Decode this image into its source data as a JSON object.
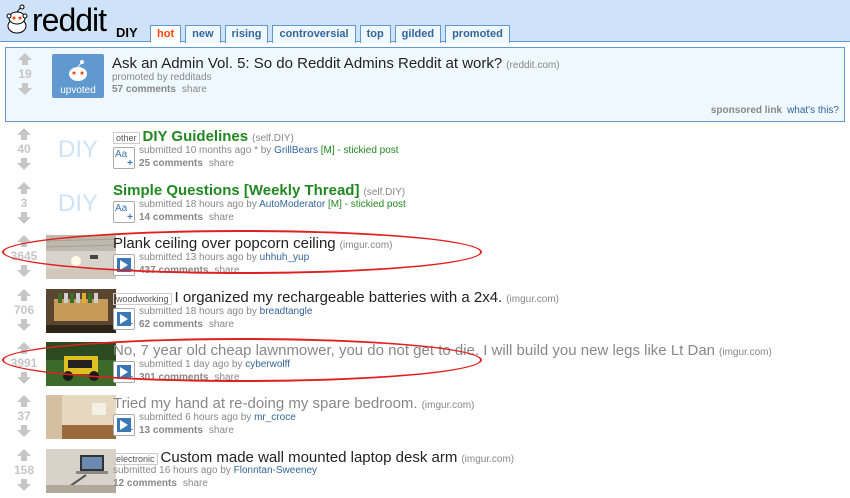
{
  "header": {
    "logo_text": "reddit",
    "subreddit": "DIY",
    "tabs": [
      "hot",
      "new",
      "rising",
      "controversial",
      "top",
      "gilded",
      "promoted"
    ],
    "selected_tab": "hot"
  },
  "sponsored": {
    "score": "19",
    "thumb_label": "upvoted",
    "title": "Ask an Admin Vol. 5: So do Reddit Admins Reddit at work?",
    "domain": "(reddit.com)",
    "tagline": "promoted by redditads",
    "comments": "57 comments",
    "share": "share",
    "sponsored_label": "sponsored link",
    "whats_this": "what's this?"
  },
  "posts": [
    {
      "score": "40",
      "watermark": "DIY",
      "flair": "other",
      "title": "DIY Guidelines",
      "domain": "(self.DIY)",
      "tag_prefix": "submitted 10 months ago * by ",
      "author": "GrillBears",
      "tag_suffix": " [M] - stickied post",
      "comments": "25 comments",
      "share": "share"
    },
    {
      "score": "3",
      "watermark": "DIY",
      "title": "Simple Questions [Weekly Thread]",
      "domain": "(self.DIY)",
      "tag_prefix": "submitted 18 hours ago by ",
      "author": "AutoModerator",
      "tag_suffix": " [M] - stickied post",
      "comments": "14 comments",
      "share": "share"
    },
    {
      "score": "3645",
      "title": "Plank ceiling over popcorn ceiling",
      "domain": "(imgur.com)",
      "tag_prefix": "submitted 13 hours ago by ",
      "author": "uhhuh_yup",
      "comments": "437 comments",
      "share": "share"
    },
    {
      "score": "706",
      "flair": "woodworking",
      "title": "I organized my rechargeable batteries with a 2x4.",
      "domain": "(imgur.com)",
      "tag_prefix": "submitted 18 hours ago by ",
      "author": "breadtangle",
      "comments": "62 comments",
      "share": "share"
    },
    {
      "score": "3991",
      "title": "No, 7 year old cheap lawnmower, you do not get to die. I will build you new legs like Lt Dan",
      "domain": "(imgur.com)",
      "tag_prefix": "submitted 1 day ago by ",
      "author": "cyberwolff",
      "comments": "301 comments",
      "share": "share"
    },
    {
      "score": "37",
      "title": "Tried my hand at re-doing my spare bedroom.",
      "domain": "(imgur.com)",
      "tag_prefix": "submitted 6 hours ago by ",
      "author": "mr_croce",
      "comments": "13 comments",
      "share": "share"
    },
    {
      "score": "158",
      "flair": "electronic",
      "title": "Custom made wall mounted laptop desk arm",
      "domain": "(imgur.com)",
      "tag_prefix": "submitted 16 hours ago by ",
      "author": "Flonntan-Sweeney",
      "comments": "12 comments",
      "share": "share"
    }
  ],
  "colors": {
    "header_bg": "#cee3f8",
    "accent_orange": "#ff4500",
    "link_blue": "#0000ff",
    "stickied_green": "#228822",
    "annotation_red": "#e02020"
  }
}
